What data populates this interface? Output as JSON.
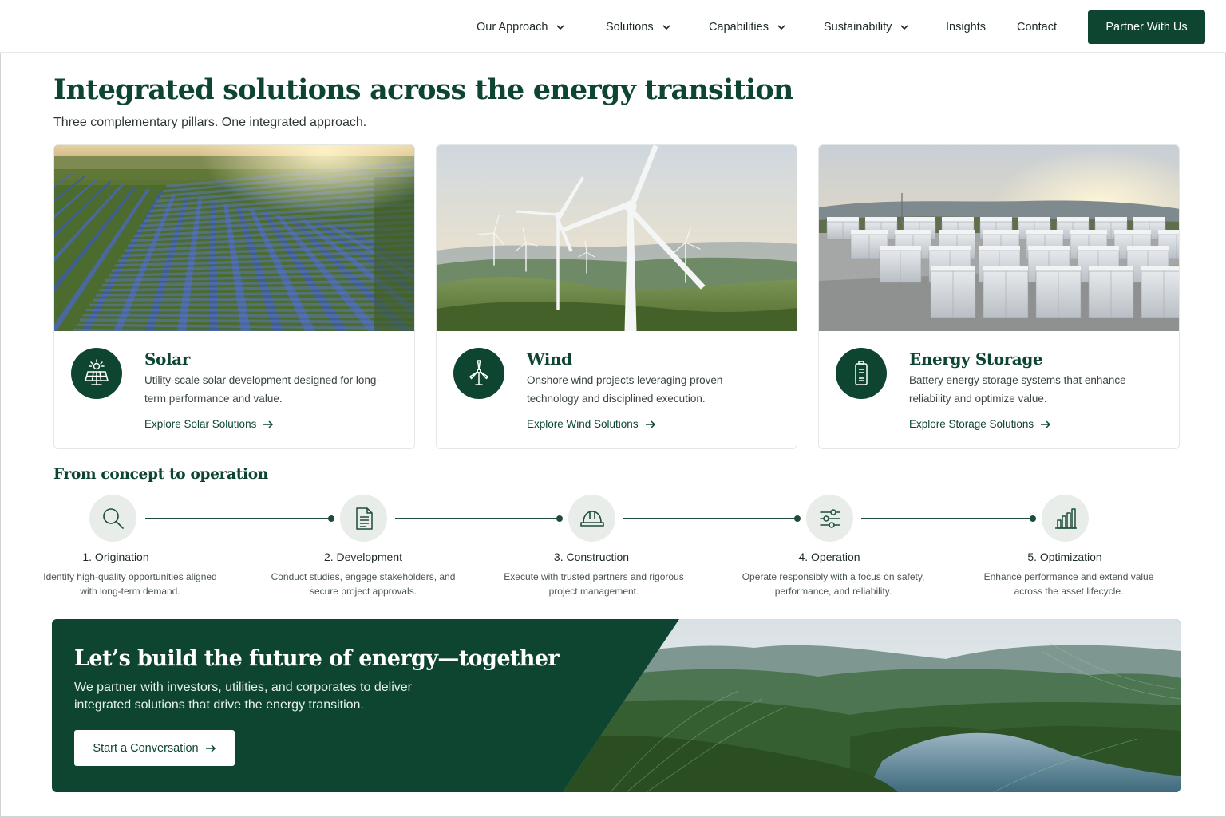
{
  "nav": {
    "items": [
      {
        "label": "Our Approach",
        "dropdown": true
      },
      {
        "label": "Solutions",
        "dropdown": true
      },
      {
        "label": "Capabilities",
        "dropdown": true
      },
      {
        "label": "Sustainability",
        "dropdown": true
      },
      {
        "label": "Insights",
        "dropdown": false
      },
      {
        "label": "Contact",
        "dropdown": false
      }
    ],
    "cta": "Partner With Us"
  },
  "hero": {
    "title": "Integrated solutions across the energy transition",
    "subtitle": "Three complementary pillars. One integrated approach."
  },
  "cards": [
    {
      "title": "Solar",
      "description": "Utility-scale solar development designed for long-term performance and value.",
      "link": "Explore Solar Solutions",
      "icon": "solar-panel-icon"
    },
    {
      "title": "Wind",
      "description": "Onshore wind projects leveraging proven technology and disciplined execution.",
      "link": "Explore Wind Solutions",
      "icon": "wind-turbine-icon"
    },
    {
      "title": "Energy Storage",
      "description": "Battery energy storage systems that enhance reliability and optimize value.",
      "link": "Explore Storage Solutions",
      "icon": "battery-icon"
    }
  ],
  "process": {
    "title": "From concept to operation",
    "steps": [
      {
        "title": "1. Origination",
        "description": "Identify high-quality opportunities aligned with long-term demand.",
        "icon": "search-icon"
      },
      {
        "title": "2. Development",
        "description": "Conduct studies, engage stakeholders, and secure project approvals.",
        "icon": "document-icon"
      },
      {
        "title": "3. Construction",
        "description": "Execute with trusted partners and rigorous project management.",
        "icon": "hard-hat-icon"
      },
      {
        "title": "4. Operation",
        "description": "Operate responsibly with a focus on safety, performance, and reliability.",
        "icon": "sliders-icon"
      },
      {
        "title": "5. Optimization",
        "description": "Enhance performance and extend value across the asset lifecycle.",
        "icon": "bar-chart-icon"
      }
    ]
  },
  "banner": {
    "title": "Let’s build the future of energy—together",
    "description": "We partner with investors, utilities, and corporates to deliver integrated solutions that drive the energy transition.",
    "button": "Start a Conversation"
  },
  "colors": {
    "brand": "#0d4531",
    "step_circle": "#e8ede9",
    "card_border": "#e3e7e5"
  }
}
